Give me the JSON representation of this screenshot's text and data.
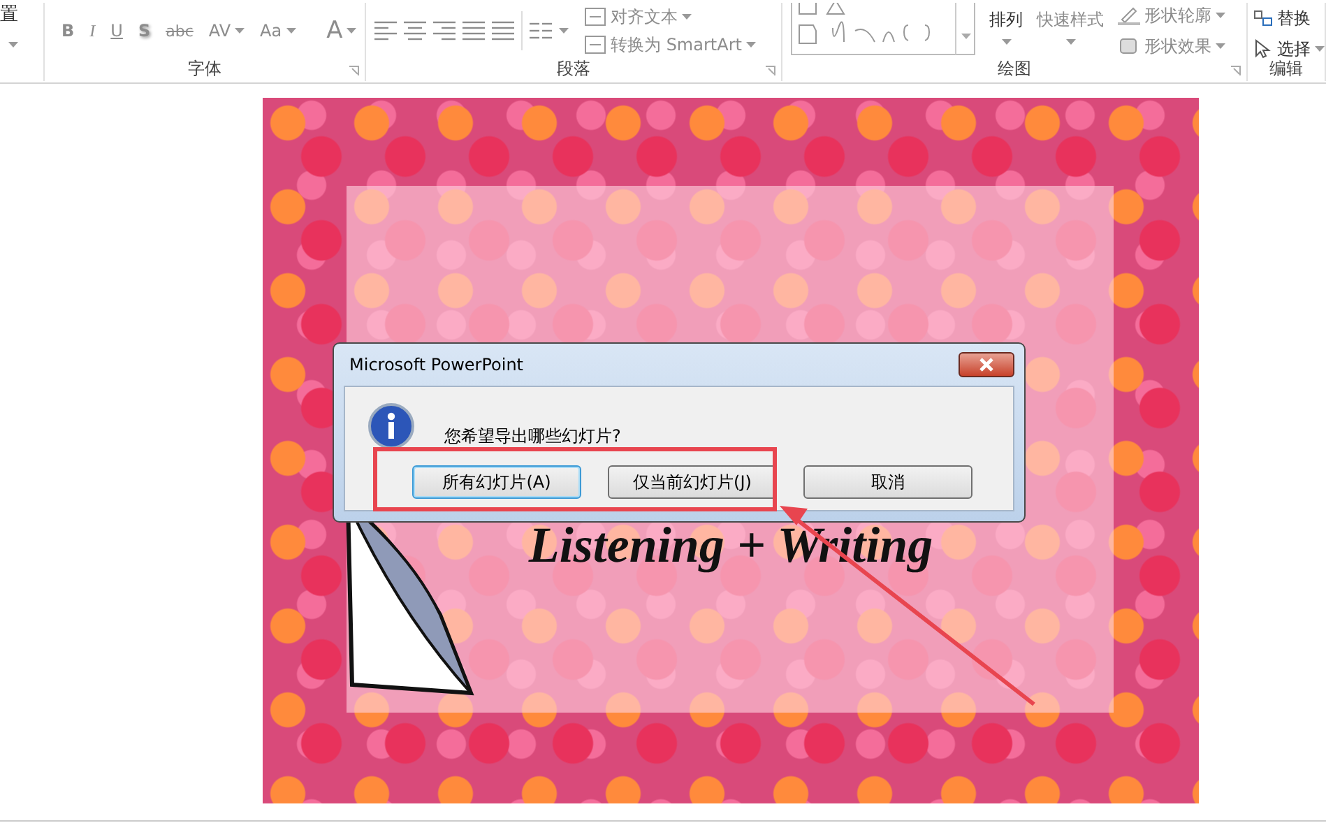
{
  "ribbon": {
    "groups": [
      {
        "buttons": [
          "置"
        ]
      },
      {
        "label": "字体",
        "buttons": [
          "B",
          "I",
          "U",
          "S",
          "abc",
          "AV",
          "Aa",
          "A"
        ]
      },
      {
        "label": "段落",
        "buttons": [
          "对齐文本",
          "转换为 SmartArt"
        ]
      },
      {
        "label": "绘图",
        "buttons": [
          "排列",
          "快速样式",
          "形状轮廓",
          "形状效果"
        ]
      },
      {
        "label": "编辑",
        "buttons": [
          "替换",
          "选择"
        ]
      }
    ]
  },
  "slide": {
    "title": "Listening + Writing"
  },
  "dialog": {
    "title": "Microsoft PowerPoint",
    "message": "您希望导出哪些幻灯片?",
    "buttons": [
      {
        "label": "所有幻灯片(A)",
        "default": true
      },
      {
        "label": "仅当前幻灯片(J)",
        "default": false
      },
      {
        "label": "取消",
        "default": false
      }
    ]
  }
}
